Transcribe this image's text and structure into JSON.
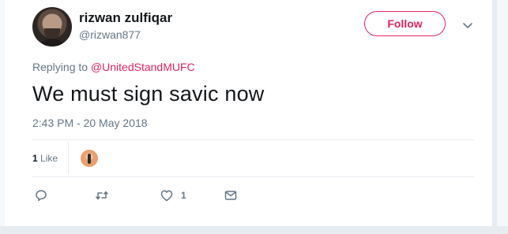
{
  "author": {
    "display_name": "rizwan zulfiqar",
    "handle": "@rizwan877"
  },
  "header": {
    "follow_label": "Follow",
    "accent_color": "#e0245e"
  },
  "tweet": {
    "replying_prefix": "Replying to",
    "replying_to": "@UnitedStandMUFC",
    "text": "We must sign savic now",
    "timestamp": "2:43 PM - 20 May 2018"
  },
  "stats": {
    "likes_number": "1",
    "likes_word": "Like"
  },
  "actions": {
    "reply_icon": "reply-icon",
    "retweet_icon": "retweet-icon",
    "like_icon": "heart-icon",
    "like_count": "1",
    "dm_icon": "envelope-icon"
  }
}
